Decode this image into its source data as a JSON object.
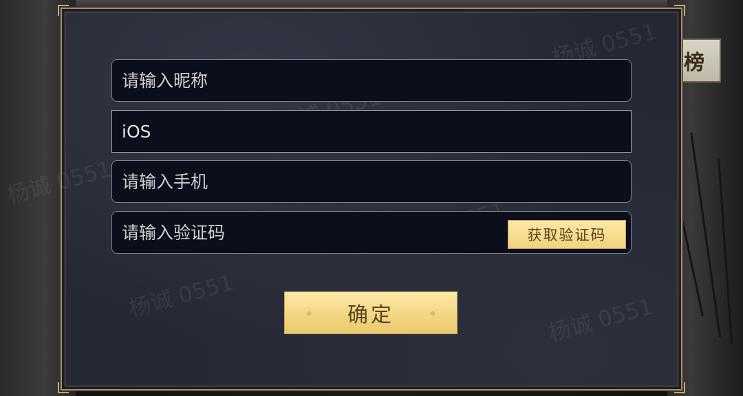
{
  "background": {
    "rank_tab_char": "榜"
  },
  "watermark": "杨诚 0551",
  "form": {
    "nickname": {
      "placeholder": "请输入昵称",
      "value": ""
    },
    "platform": {
      "value": "iOS"
    },
    "phone": {
      "placeholder": "请输入手机",
      "value": ""
    },
    "code": {
      "placeholder": "请输入验证码",
      "value": ""
    },
    "get_code_label": "获取验证码",
    "confirm_label": "确定"
  },
  "colors": {
    "panel_bg": "#242834",
    "field_bg": "#0b0f1c",
    "button_gold": "#f3d683",
    "frame_gold": "#a88f68"
  }
}
